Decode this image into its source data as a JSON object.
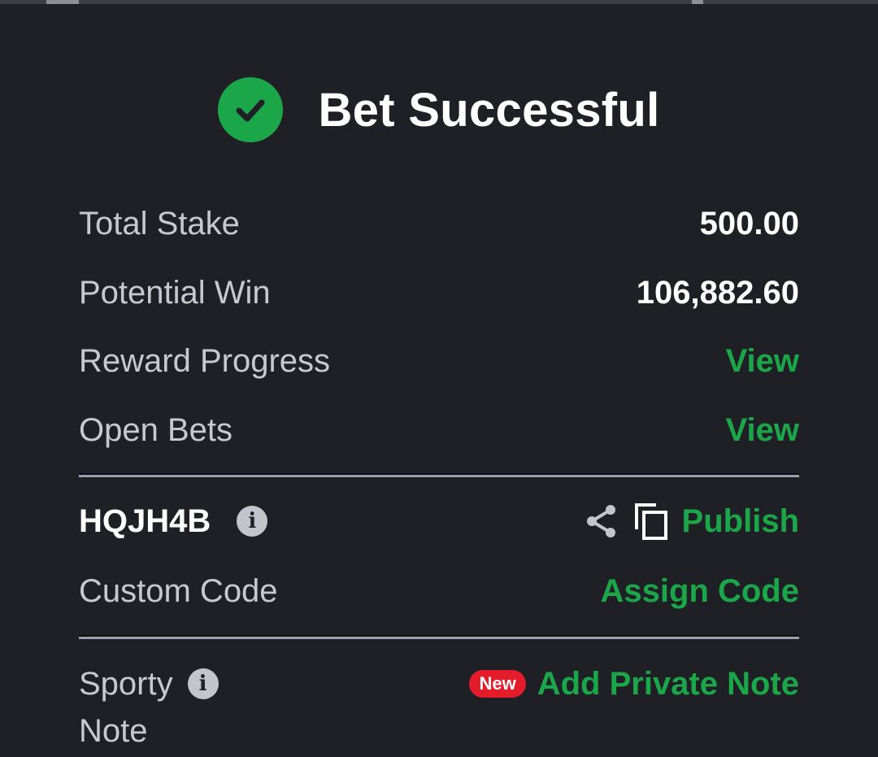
{
  "header": {
    "title": "Bet Successful"
  },
  "summary": {
    "total_stake_label": "Total Stake",
    "total_stake_value": "500.00",
    "potential_win_label": "Potential Win",
    "potential_win_value": "106,882.60",
    "reward_progress_label": "Reward Progress",
    "reward_progress_link": "View",
    "open_bets_label": "Open Bets",
    "open_bets_link": "View"
  },
  "booking": {
    "code": "HQJH4B",
    "publish_label": "Publish",
    "custom_code_label": "Custom Code",
    "assign_code_label": "Assign Code"
  },
  "note": {
    "label_line1": "Sporty",
    "label_line2": "Note",
    "new_badge": "New",
    "add_note_label": "Add Private Note"
  },
  "colors": {
    "background": "#1f2026",
    "accent_green": "#1ca64a",
    "badge_red": "#e41b2b"
  },
  "icons": {
    "header": "check-circle-icon",
    "info": "info-icon",
    "share": "share-icon",
    "copy": "copy-icon"
  }
}
